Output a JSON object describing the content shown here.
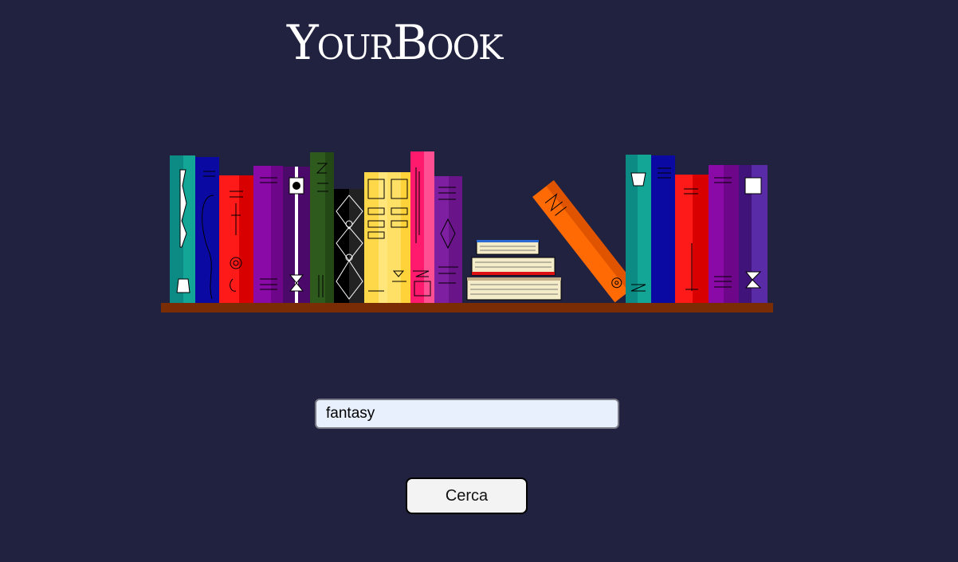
{
  "brand": {
    "logo_text": "YourBook"
  },
  "search": {
    "value": "fantasy",
    "placeholder": ""
  },
  "actions": {
    "search_button_label": "Cerca"
  },
  "colors": {
    "background": "#212140",
    "shelf": "#7a2d05",
    "input_background": "#e8f0fe",
    "button_background": "#f3f3f3"
  }
}
